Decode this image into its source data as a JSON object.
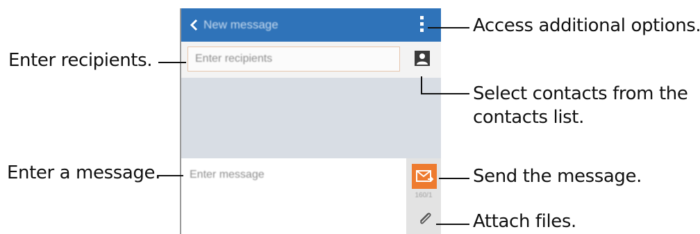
{
  "app": {
    "title": "New message"
  },
  "recipients": {
    "placeholder": "Enter recipients"
  },
  "compose": {
    "placeholder": "Enter message",
    "char_counter": "160/1"
  },
  "icons": {
    "back": "chevron-left-icon",
    "more": "more-vertical-icon",
    "contacts": "contact-icon",
    "send": "send-icon",
    "attach": "paperclip-icon"
  },
  "callouts": {
    "recipients": "Enter recipients.",
    "message": "Enter a message.",
    "options": "Access additional options.",
    "contacts_line1": "Select contacts from the",
    "contacts_line2": "contacts list.",
    "send": "Send the message.",
    "attach": "Attach files."
  },
  "colors": {
    "app_bar": "#2f73b9",
    "send_button": "#ee7b2f",
    "conversation_bg": "#d8dde4"
  }
}
